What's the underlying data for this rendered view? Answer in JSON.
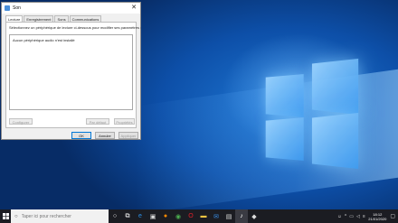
{
  "dialog": {
    "title": "Son",
    "close": "✕",
    "tabs": [
      {
        "label": "Lecture",
        "active": true
      },
      {
        "label": "Enregistrement",
        "active": false
      },
      {
        "label": "Sons",
        "active": false
      },
      {
        "label": "Communications",
        "active": false
      }
    ],
    "instruction": "Sélectionnez un périphérique de lecture ci-dessous pour modifier ses paramètres :",
    "no_device": "Aucun périphérique audio n'est installé",
    "buttons": {
      "configure": "Configurer",
      "set_default": "Par défaut",
      "properties": "Propriétés",
      "ok": "OK",
      "cancel": "Annuler",
      "apply": "Appliquer"
    }
  },
  "taskbar": {
    "search_placeholder": "Taper ici pour rechercher",
    "pinned": [
      "task-view-icon",
      "edge-icon",
      "store-icon",
      "firefox-icon",
      "chrome-icon",
      "opera-icon",
      "file-explorer-icon",
      "mail-icon",
      "photos-icon",
      "sound-settings-icon",
      "app-icon"
    ],
    "clock_time": "18:12",
    "clock_date": "21/01/2020"
  }
}
